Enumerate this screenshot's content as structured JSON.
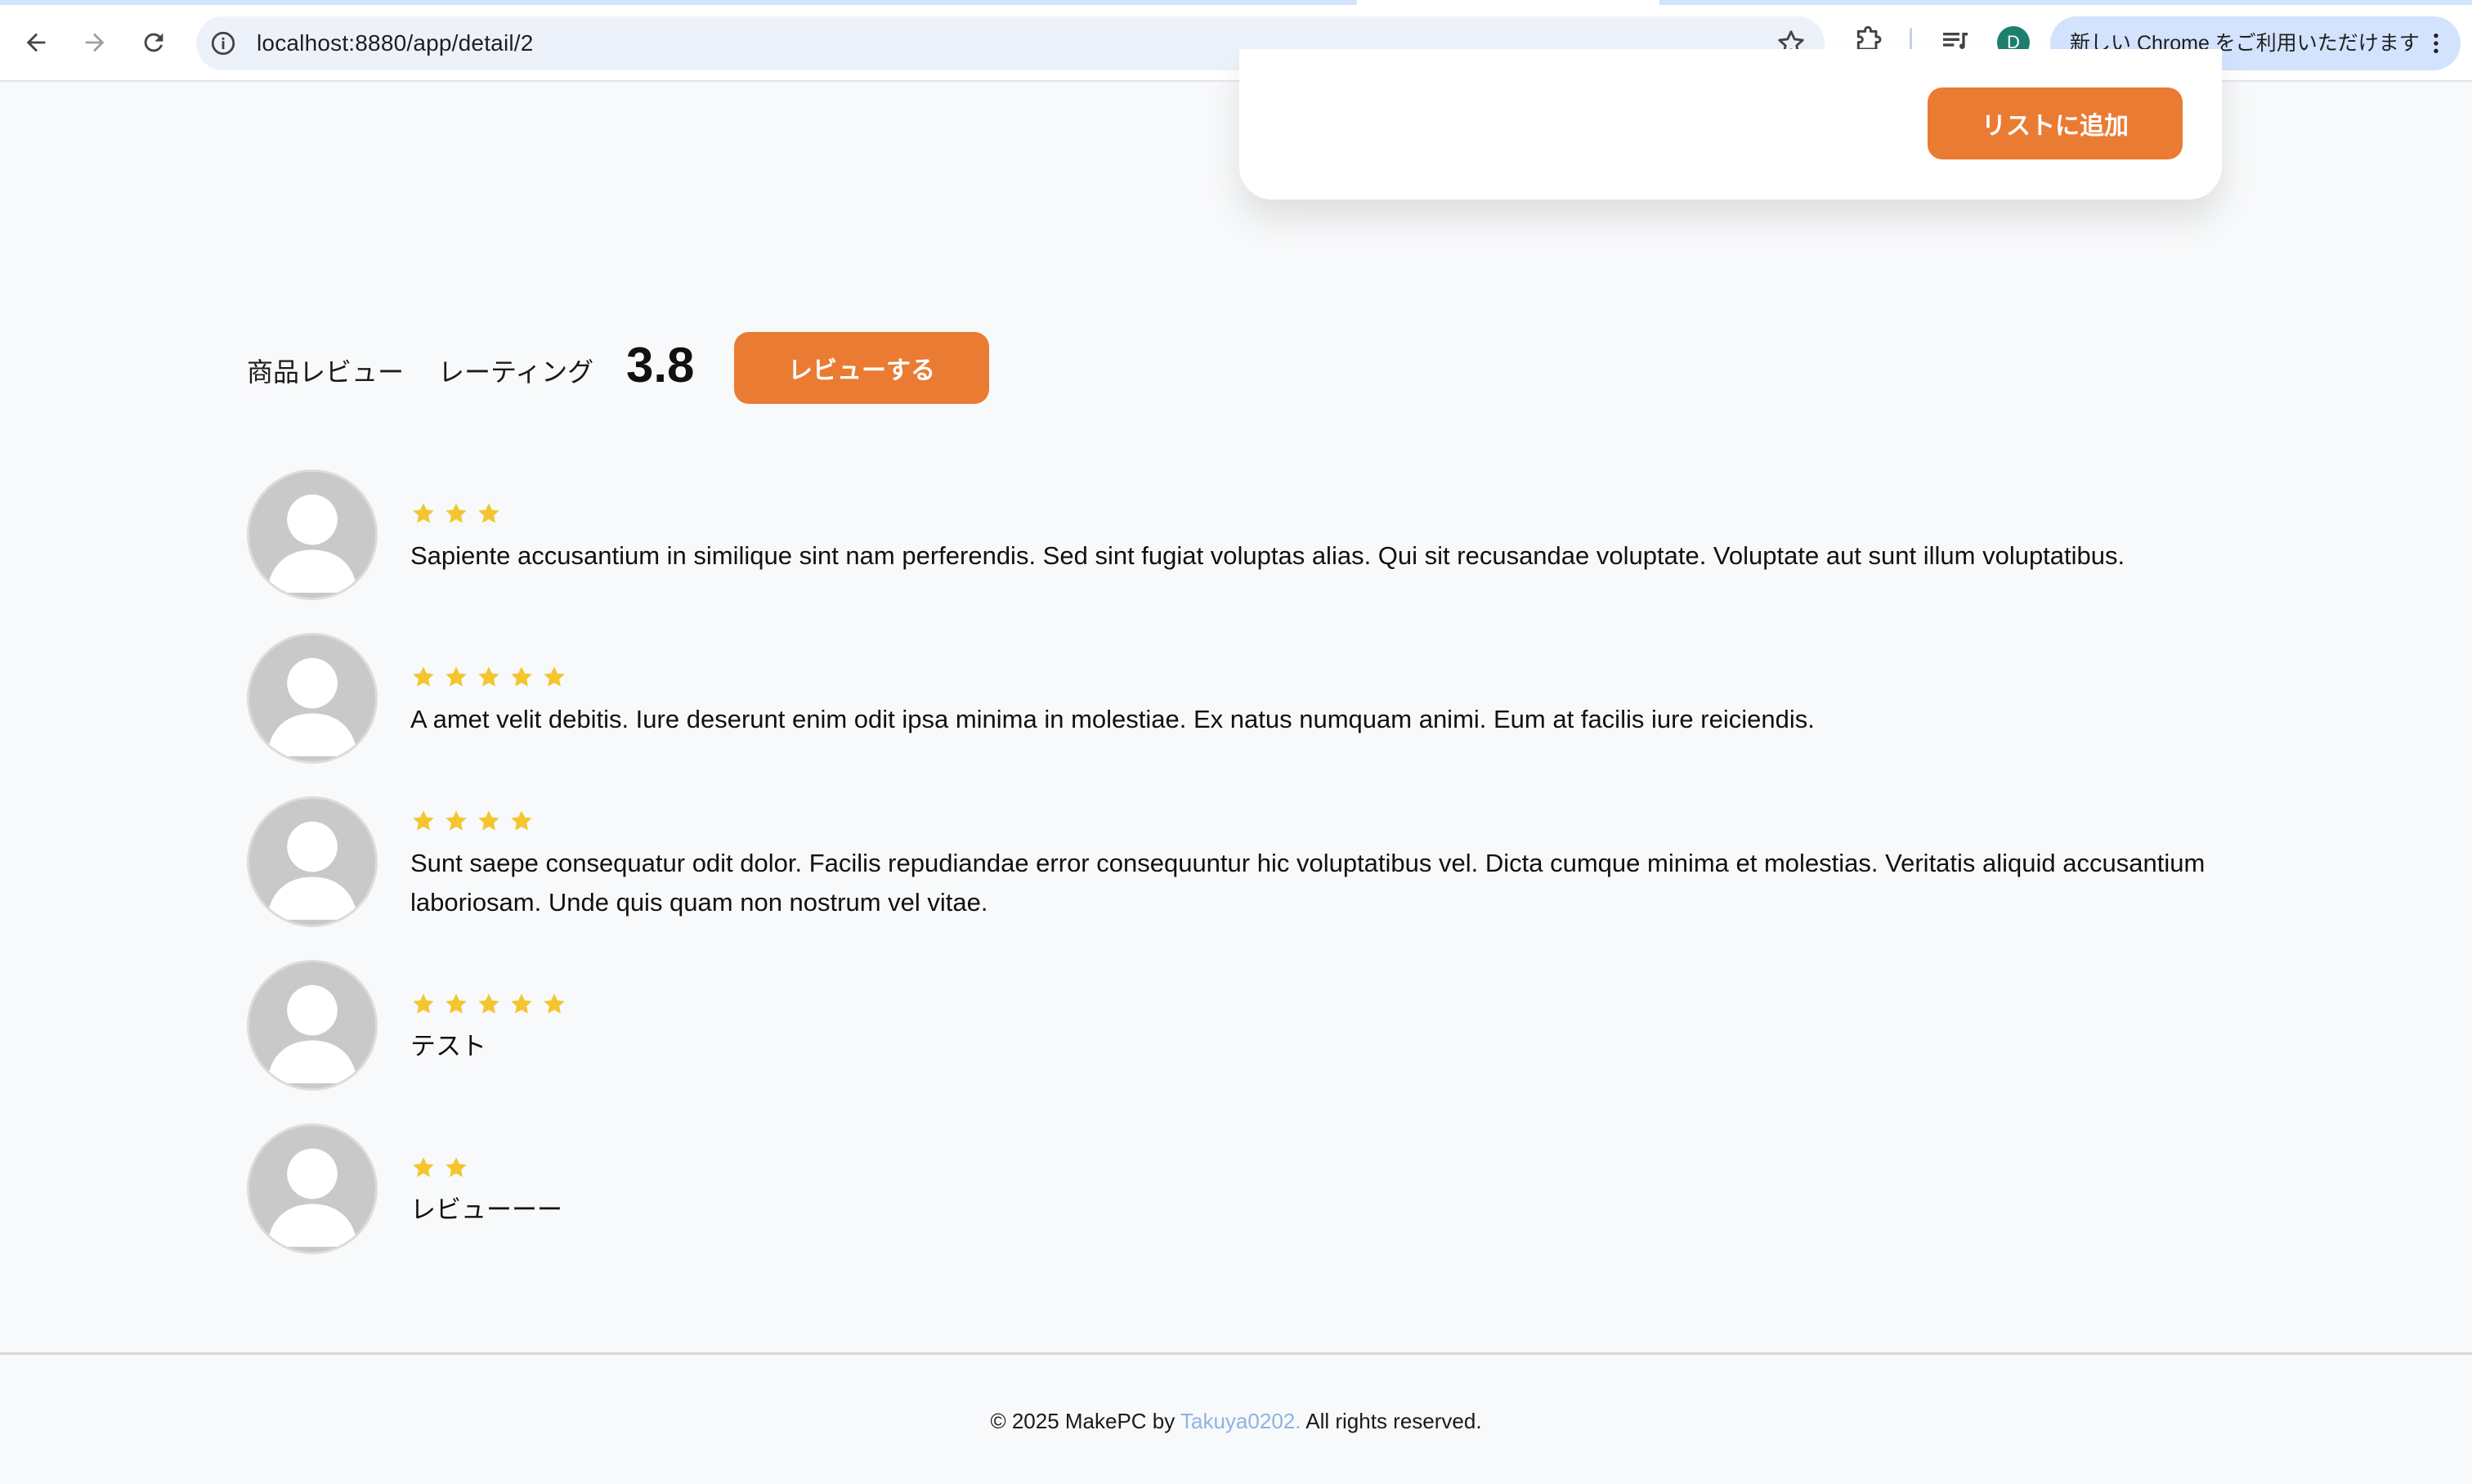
{
  "browser": {
    "url": "localhost:8880/app/detail/2",
    "profile_initial": "D",
    "update_label": "新しい Chrome をご利用いただけます"
  },
  "product": {
    "add_to_list_label": "リストに追加"
  },
  "reviews": {
    "title": "商品レビュー",
    "rating_label": "レーティング",
    "rating_value": "3.8",
    "write_review_label": "レビューする",
    "items": [
      {
        "stars": 3,
        "text": "Sapiente accusantium in similique sint nam perferendis. Sed sint fugiat voluptas alias. Qui sit recusandae voluptate. Voluptate aut sunt illum voluptatibus."
      },
      {
        "stars": 5,
        "text": "A amet velit debitis. Iure deserunt enim odit ipsa minima in molestiae. Ex natus numquam animi. Eum at facilis iure reiciendis."
      },
      {
        "stars": 4,
        "text": "Sunt saepe consequatur odit dolor. Facilis repudiandae error consequuntur hic voluptatibus vel. Dicta cumque minima et molestias. Veritatis aliquid accusantium laboriosam. Unde quis quam non nostrum vel vitae."
      },
      {
        "stars": 5,
        "text": "テスト"
      },
      {
        "stars": 2,
        "text": "レビューーー"
      }
    ]
  },
  "footer": {
    "prefix": "© 2025 MakePC by ",
    "author": "Takuya0202.",
    "suffix": " All rights reserved."
  },
  "colors": {
    "accent": "#ea7b33",
    "star": "#f5c52f",
    "link": "#8fb3e2",
    "background": "#f8f9fa"
  }
}
